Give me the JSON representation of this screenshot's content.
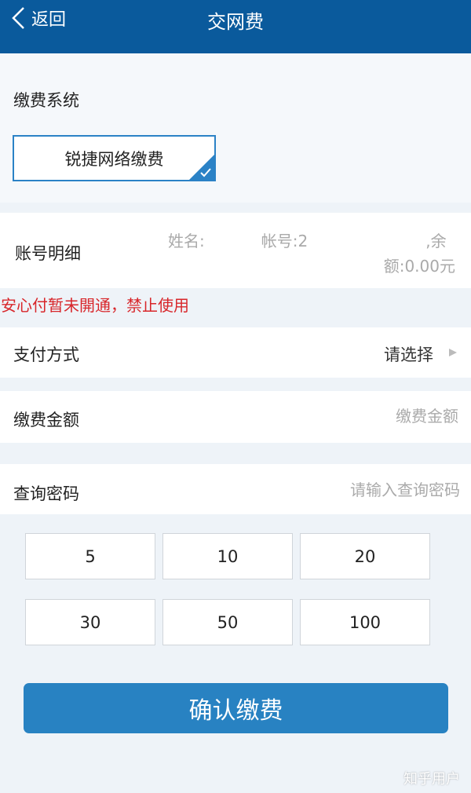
{
  "header": {
    "back_label": "返回",
    "title": "交网费"
  },
  "payment_system": {
    "label": "缴费系统",
    "selected_option": "锐捷网络缴费"
  },
  "account": {
    "label": "账号明细",
    "name_prefix": "姓名:",
    "account_prefix": "帐号:2",
    "balance_suffix": ",余",
    "balance_line": "额:0.00元"
  },
  "warning": "安心付暂未開通，禁止使用",
  "payment_method": {
    "label": "支付方式",
    "value": "请选择"
  },
  "amount": {
    "label": "缴费金额",
    "placeholder": "缴费金额"
  },
  "password": {
    "label": "查询密码",
    "placeholder": "请输入查询密码"
  },
  "quick_amounts": [
    "5",
    "10",
    "20",
    "30",
    "50",
    "100"
  ],
  "confirm_label": "确认缴费",
  "watermark": "知乎用户",
  "colors": {
    "header_bg": "#0a5a9c",
    "accent": "#2882c2",
    "warning": "#d8262a"
  }
}
